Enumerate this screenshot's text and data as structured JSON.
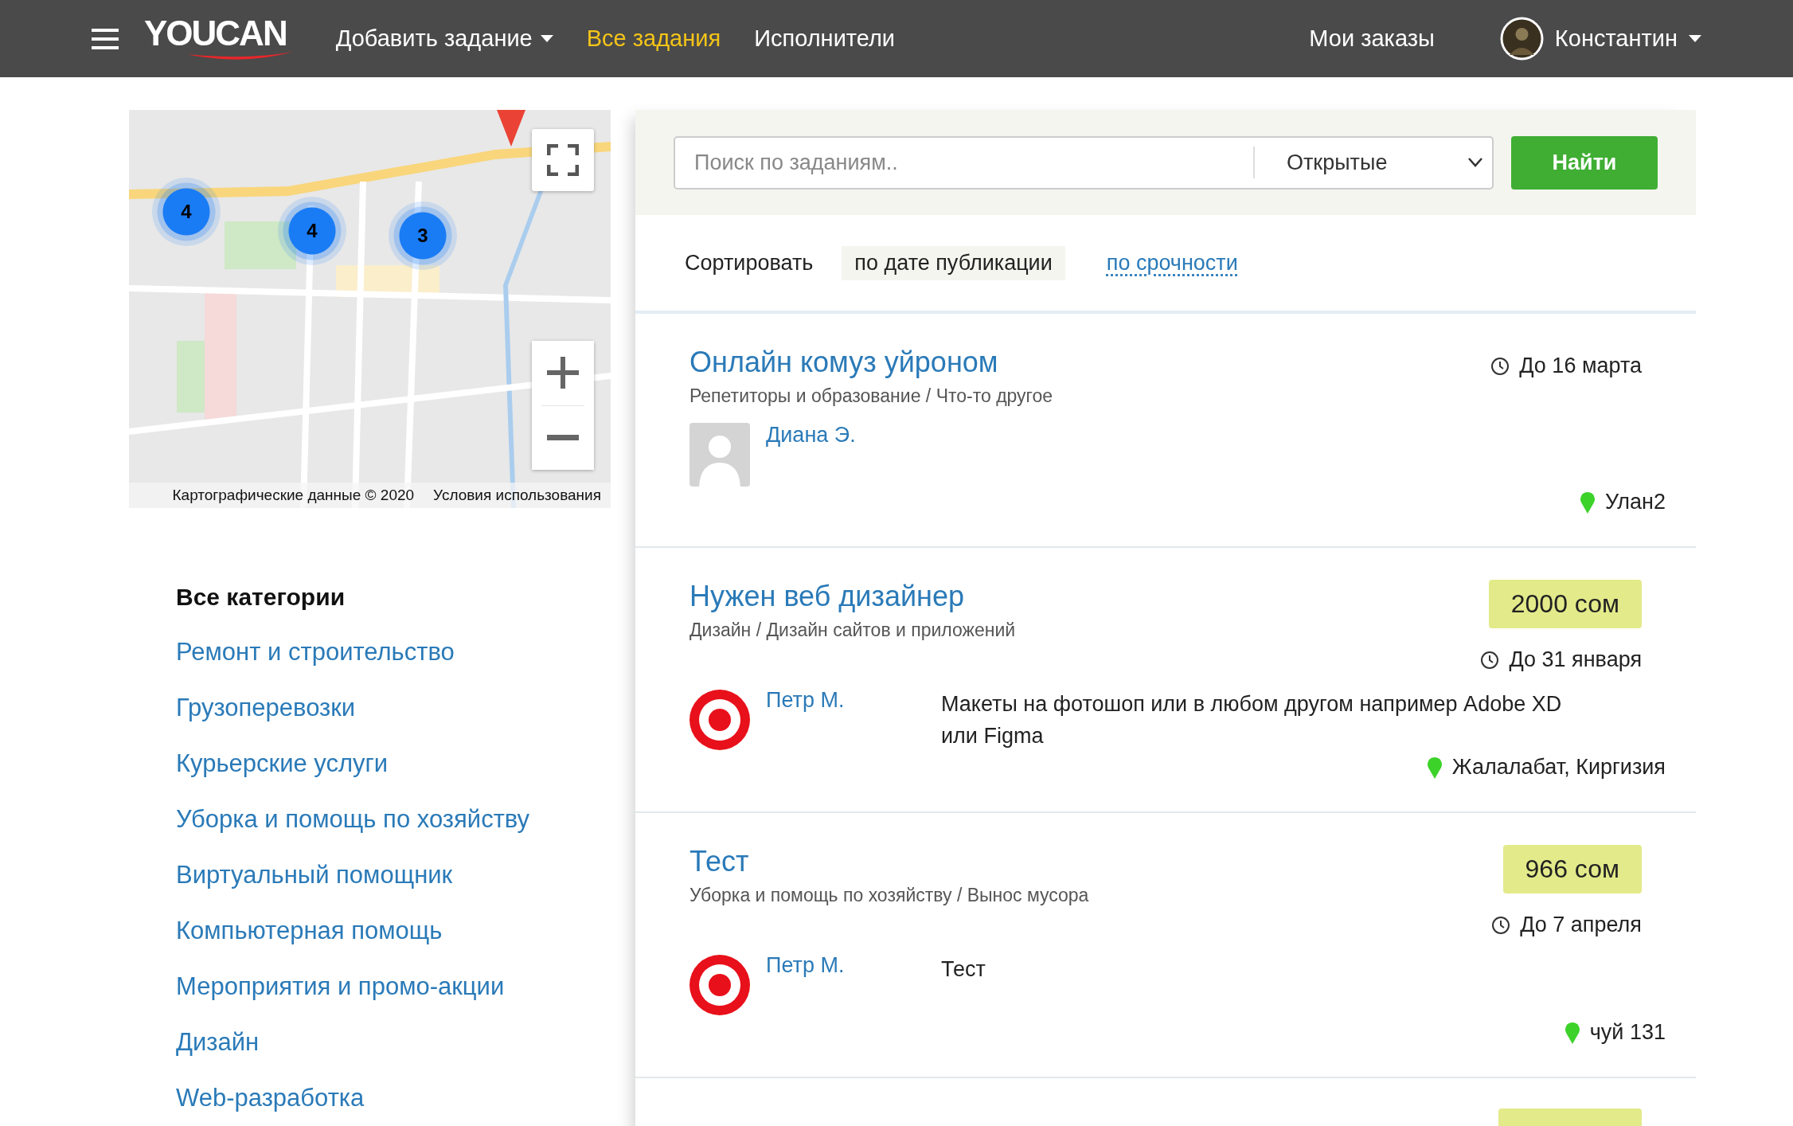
{
  "header": {
    "logo": "YOUCAN",
    "nav": [
      {
        "label": "Добавить задание",
        "selected": false,
        "dropdown": true
      },
      {
        "label": "Все задания",
        "selected": true,
        "dropdown": false
      },
      {
        "label": "Исполнители",
        "selected": false,
        "dropdown": false
      }
    ],
    "my_orders": "Мои заказы",
    "user": {
      "name": "Константин"
    }
  },
  "map": {
    "clusters": [
      {
        "count": "4"
      },
      {
        "count": "4"
      },
      {
        "count": "3"
      }
    ],
    "attribution": "Картографические данные © 2020",
    "terms": "Условия использования"
  },
  "search": {
    "placeholder": "Поиск по заданиям..",
    "filter": "Открытые",
    "button": "Найти"
  },
  "sort": {
    "label": "Сортировать",
    "options": [
      {
        "label": "по дате публикации",
        "selected": true
      },
      {
        "label": "по срочности",
        "selected": false
      }
    ]
  },
  "tasks": [
    {
      "title": "Онлайн комуз уйроном",
      "category": "Репетиторы и образование / Что-то другое",
      "deadline": "До 16 марта",
      "author": "Диана Э.",
      "avatar": {
        "kind": "placeholder"
      },
      "location": "Улан2"
    },
    {
      "title": "Нужен веб дизайнер",
      "category": "Дизайн / Дизайн сайтов и приложений",
      "price": "2000 сом",
      "deadline": "До 31 января",
      "author": "Петр М.",
      "avatar": {
        "kind": "target"
      },
      "description": "Макеты на фотошоп или в любом другом например Adobe XD или Figma",
      "location": "Жалалабат, Киргизия"
    },
    {
      "title": "Тест",
      "category": "Уборка и помощь по хозяйству / Вынос мусора",
      "price": "966 сом",
      "deadline": "До 7 апреля",
      "author": "Петр М.",
      "avatar": {
        "kind": "target"
      },
      "description": "Тест",
      "location": "чуй 131"
    }
  ],
  "categories": {
    "title": "Все категории",
    "items": [
      "Ремонт и строительство",
      "Грузоперевозки",
      "Курьерские услуги",
      "Уборка и помощь по хозяйству",
      "Виртуальный помощник",
      "Компьютерная помощь",
      "Мероприятия и промо-акции",
      "Дизайн",
      "Web-разработка"
    ]
  }
}
